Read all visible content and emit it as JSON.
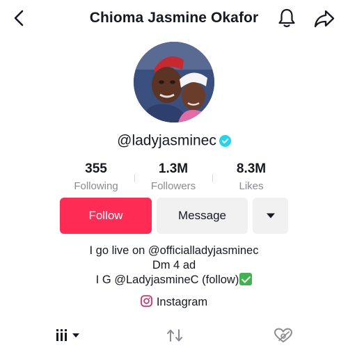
{
  "header": {
    "title": "Chioma Jasmine Okafor"
  },
  "profile": {
    "handle": "@ladyjasminec",
    "verified": true
  },
  "stats": [
    {
      "value": "355",
      "label": "Following"
    },
    {
      "value": "1.3M",
      "label": "Followers"
    },
    {
      "value": "8.3M",
      "label": "Likes"
    }
  ],
  "actions": {
    "follow_label": "Follow",
    "message_label": "Message",
    "more_icon": "caret-down-icon"
  },
  "bio": {
    "line1": "I go live on @officialladyjasminec",
    "line2": "Dm  4 ad",
    "line3": "I G @LadyjasmineC (follow)"
  },
  "link": {
    "label": "Instagram",
    "icon": "instagram-icon"
  },
  "tabs": [
    {
      "icon": "videos-grid-icon"
    },
    {
      "icon": "repost-icon"
    },
    {
      "icon": "liked-hidden-icon"
    }
  ],
  "colors": {
    "accent": "#fe2c55",
    "verified": "#20d5ec",
    "secondary_button": "#f1f1f2",
    "muted_text": "#8a8b91"
  }
}
